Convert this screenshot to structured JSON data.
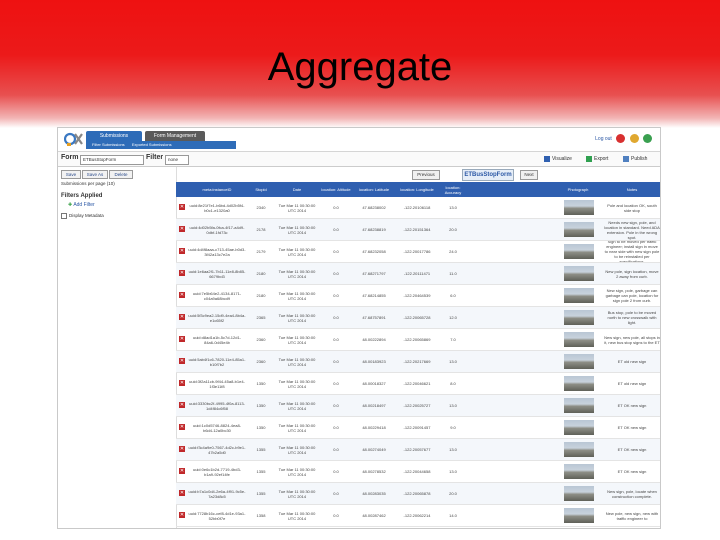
{
  "slide": {
    "title": "Aggregate"
  },
  "app": {
    "tabs": [
      "Submissions",
      "Form Management"
    ],
    "subtabs": [
      "Filter Submissions",
      "Exported Submissions"
    ],
    "log_out": "Log out",
    "toolbar": {
      "form_label": "Form",
      "form_value": "ETBusStopForm",
      "filter_label": "Filter",
      "filter_value": "none",
      "visualize": "Visualize",
      "export": "Export",
      "publish": "Publish"
    },
    "left": {
      "save": "Save",
      "save_as": "Save As",
      "delete": "Delete",
      "per_page": "Submissions per page (10)",
      "filters_applied": "Filters Applied",
      "add_filter": "Add Filter",
      "display_metadata": "Display Metadata"
    },
    "pager": {
      "previous": "Previous",
      "current": "ETBusStopForm",
      "next": "Next"
    },
    "columns": [
      "",
      "meta:instanceID",
      "Stopid",
      "Date",
      "location: Altitude",
      "location: Latitude",
      "location: Longitude",
      "location: Accuracy",
      "Photograph",
      "Notes"
    ],
    "rows": [
      {
        "id": "uuid:8e21f7e1-b6bd-4d02b5f4-b0c1-e1320a0",
        "stop": "2340",
        "date": "Tue Mar 11 00:30:00 UTC 2014",
        "alt": "0.0",
        "lat": "47.68238002",
        "lon": "-122.20106118",
        "acc": "13.0",
        "notes": "Pole and location OK, south side stop"
      },
      {
        "id": "uuid:4d02b5fa-0fca-4f17-a4d9-0dbf-1fd73c",
        "stop": "2178",
        "date": "Tue Mar 11 00:30:00 UTC 2014",
        "alt": "0.0",
        "lat": "47.68238819",
        "lon": "-122.20151364",
        "acc": "20.0",
        "notes": "Needs new sign, pole, and location in standard. Need ADA extension. Pole in the wrong spot."
      },
      {
        "id": "uuid:4d4f8aaa-c713-45ae-b0d3-3f42a13c7e2a",
        "stop": "2179",
        "date": "Tue Mar 11 00:30:00 UTC 2014",
        "alt": "0.0",
        "lat": "47.68232058",
        "lon": "-122.20017786",
        "acc": "24.0",
        "notes": "Sign to be moved per traffic engineer; install sign in move to near side with new sign pole to be reinstalled per specifications."
      },
      {
        "id": "uuid:1e6aa2f1-7b11-11e8-8b85-6679bd3",
        "stop": "2180",
        "date": "Tue Mar 11 00:30:00 UTC 2014",
        "alt": "0.0",
        "lat": "47.68271797",
        "lon": "-122.20111471",
        "acc": "11.0",
        "notes": "New pole, sign location, move 2 away from curb."
      },
      {
        "id": "uuid:7e5b64e2-4134-8171-c04a9a68bcd9",
        "stop": "2180",
        "date": "Tue Mar 11 00:30:00 UTC 2014",
        "alt": "0.0",
        "lat": "47.68214855",
        "lon": "-122.20464539",
        "acc": "6.0",
        "notes": "New sign, pole, garbage can garbage can pole, location for sign pole 2 from curb."
      },
      {
        "id": "uuid:5f3c9ea2-15d9-4ea4-8b4a-e1c65f2",
        "stop": "2365",
        "date": "Tue Mar 11 00:30:00 UTC 2014",
        "alt": "0.0",
        "lat": "47.68757891",
        "lon": "-122.20065728",
        "acc": "12.0",
        "notes": "Bus stop, pole to be moved north to new crosswalk with light."
      },
      {
        "id": "uuid:d8ad1a1b-5c7d-12d1-84a6-0d45e4b",
        "stop": "2360",
        "date": "Tue Mar 11 00:30:00 UTC 2014",
        "alt": "0.0",
        "lat": "48.00222894",
        "lon": "-122.20065869",
        "acc": "7.0",
        "notes": "New sign, new pole, all stops in it, new bus stop signs to the ET"
      },
      {
        "id": "uuid:5ab4f1c6-7820-11e4-85a1-b10f7b2",
        "stop": "2360",
        "date": "Tue Mar 11 00:30:00 UTC 2014",
        "alt": "0.0",
        "lat": "48.00183923",
        "lon": "-122.20217669",
        "acc": "13.0",
        "notes": "ET old new sign"
      },
      {
        "id": "uuid:3f2a11cb-9f44-45a8-b1e4-1f3e11f8",
        "stop": "1350",
        "date": "Tue Mar 11 00:30:00 UTC 2014",
        "alt": "0.0",
        "lat": "48.00018327",
        "lon": "-122.20046621",
        "acc": "8.0",
        "notes": "ET old new sign"
      },
      {
        "id": "uuid:3330bc2f-4995-4f0a-8113-1d4f84c6f58",
        "stop": "1350",
        "date": "Tue Mar 11 00:30:00 UTC 2014",
        "alt": "0.0",
        "lat": "48.00218497",
        "lon": "-122.20025727",
        "acc": "13.0",
        "notes": "ET OK new sign"
      },
      {
        "id": "uuid:1c0d5746-8824-4ea8-b6d4-12a0bc30",
        "stop": "1350",
        "date": "Tue Mar 11 00:30:00 UTC 2014",
        "alt": "0.0",
        "lat": "48.00229418",
        "lon": "-122.20091457",
        "acc": "9.0",
        "notes": "ET OK new sign"
      },
      {
        "id": "uuid:f3c4a9e0-7567-4d2c-b9e1-47b2a5d0",
        "stop": "1355",
        "date": "Tue Mar 11 00:30:00 UTC 2014",
        "alt": "0.0",
        "lat": "48.00274049",
        "lon": "-122.20057677",
        "acc": "13.0",
        "notes": "ET OK new sign"
      },
      {
        "id": "uuid:0e6c1b2d-7719-4bd3-b1a9-92ef14fe",
        "stop": "1355",
        "date": "Tue Mar 11 00:30:00 UTC 2014",
        "alt": "0.0",
        "lat": "48.00278532",
        "lon": "-122.20044658",
        "acc": "13.0",
        "notes": "ET OK new sign"
      },
      {
        "id": "uuid:b7a1c0d4-2e6a-4f91-9c5e-7a23d8c5",
        "stop": "1355",
        "date": "Tue Mar 11 00:30:00 UTC 2014",
        "alt": "0.0",
        "lat": "48.00283035",
        "lon": "-122.20065878",
        "acc": "20.0",
        "notes": "New sign, pole, locate when construction complete."
      },
      {
        "id": "uuid:7728b16c-cef8-4d1e-93a1-52bb0f7e",
        "stop": "1358",
        "date": "Tue Mar 11 00:30:00 UTC 2014",
        "alt": "0.0",
        "lat": "48.00287462",
        "lon": "-122.20062214",
        "acc": "14.0",
        "notes": "New pole, new sign, new with traffic engineer to"
      }
    ]
  }
}
